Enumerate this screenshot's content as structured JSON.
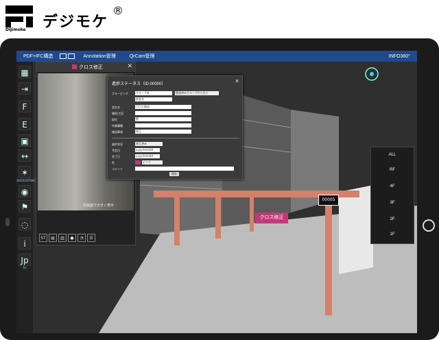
{
  "brand": {
    "name": "デジモケ",
    "registered": "®",
    "small": "DiJimoke"
  },
  "topbar": {
    "items": [
      "PDF+IFC構造",
      "Annotation管理",
      "QrCam管理"
    ],
    "right": "INFO360°"
  },
  "sidebar": {
    "buttons": [
      "▦",
      "⇥",
      "F",
      "E",
      "▣",
      "↔",
      "✶",
      "◉",
      "⚑",
      "◌",
      "i",
      "Jp"
    ],
    "labels": {
      "b6": "3DCRUSTMAC",
      "b11": "En"
    }
  },
  "camera_panel": {
    "title": "クロス修正",
    "caption": "別画面で大きく表示",
    "tools": [
      "ST",
      "▤",
      "▥",
      "●",
      "◔",
      "☰"
    ]
  },
  "form": {
    "title": "進捗ステータス（ID:00000）",
    "rows": [
      {
        "label": "グルーピング",
        "value": "グループ名",
        "select": "登録済みグループから付入"
      },
      {
        "label": "",
        "value": "部会名"
      },
      {
        "label": "会社名",
        "value": "〇〇工務店"
      },
      {
        "label": "場所/工区",
        "value": ""
      },
      {
        "label": "部位",
        "value": "壁"
      },
      {
        "label": "作業職種",
        "value": ""
      },
      {
        "label": "確認事項",
        "value": "修正"
      }
    ],
    "status_rows": [
      {
        "label": "進捗状況",
        "select": "修正済み"
      },
      {
        "label": "予定日",
        "value": "yyyy/mm/dd"
      },
      {
        "label": "完了日",
        "value": "yyyy/mm/dd"
      },
      {
        "label": "色",
        "select": "ピンク"
      },
      {
        "label": "コメント",
        "value": ""
      }
    ],
    "save": "保存"
  },
  "floors": [
    "ALL",
    "RF",
    "4F",
    "3F",
    "2F",
    "1F"
  ],
  "tags": {
    "number": "00005",
    "marker": "クロス修正"
  },
  "colors": {
    "accent": "#1f4a8c",
    "marker": "#c03a7a",
    "beam": "#d4816a"
  }
}
